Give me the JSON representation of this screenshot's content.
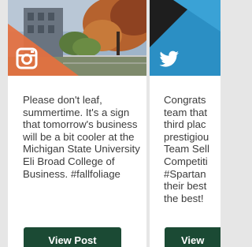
{
  "cards": [
    {
      "platform": "instagram-icon",
      "accent_color": "#e5703f",
      "text": "Please don't leaf, summertime. It's a sign that tomorrow's business will be a bit cooler at the Michigan State University Eli Broad College of Business. #fallfoliage",
      "button_label": "View Post"
    },
    {
      "platform": "twitter-icon",
      "accent_color": "#2b8fc4",
      "text": "Congrats\nteam that\nthird plac\nprestigiou\nTeam Sell\nCompetiti\n#Spartan\ntheir best\nthe best!",
      "button_label": "View"
    }
  ]
}
